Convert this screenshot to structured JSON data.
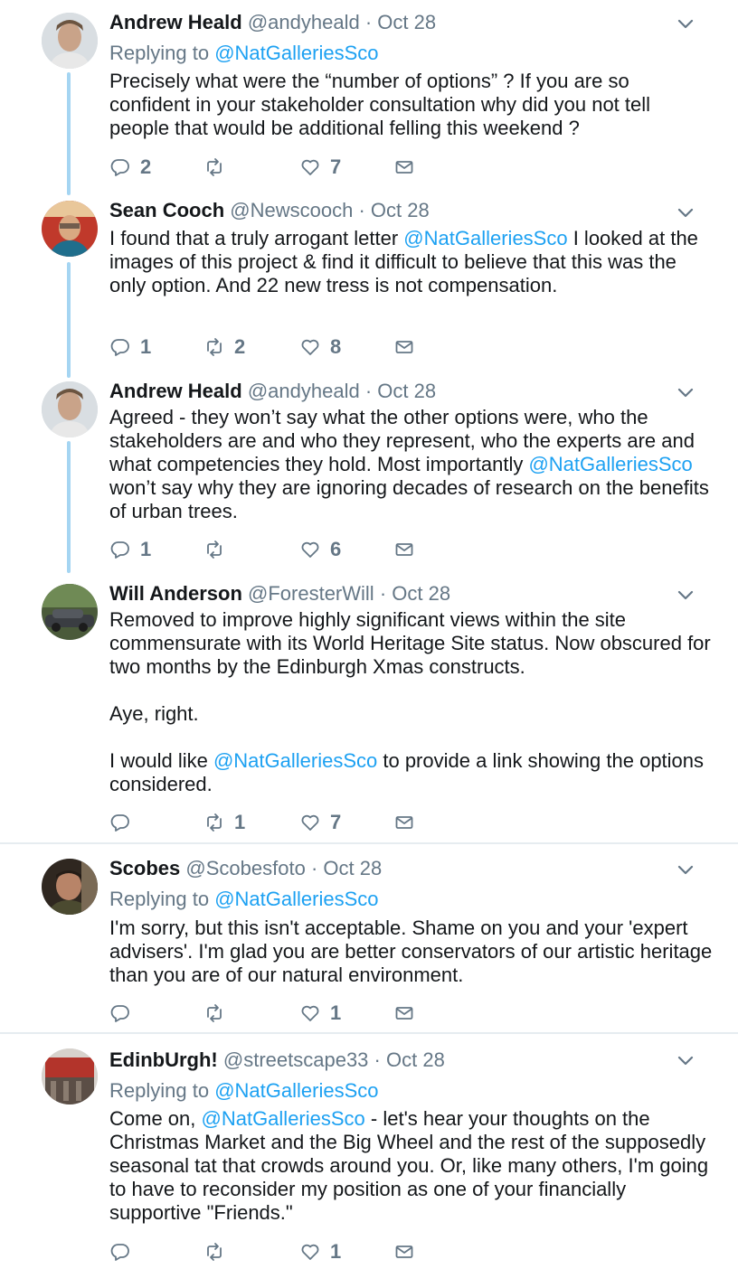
{
  "tweets": [
    {
      "name": "Andrew Heald",
      "handle": "@andyheald",
      "sep": "·",
      "time": "Oct 28",
      "replying_prefix": "Replying to",
      "replying_to": "@NatGalleriesSco",
      "text_segments": [
        [
          "Precisely what were the “number of options” ? If you are so confident  in your stakeholder consultation why did you not tell people that would be additional felling this weekend ?",
          false
        ]
      ],
      "replies": "2",
      "retweets": "",
      "likes": "7"
    },
    {
      "name": "Sean Cooch",
      "handle": "@Newscooch",
      "sep": "·",
      "time": "Oct 28",
      "text_segments": [
        [
          "I found that a truly arrogant letter ",
          false
        ],
        [
          "@NatGalleriesSco",
          true
        ],
        [
          " I looked at the images of this project & find it difficult to believe that this was the only option. And 22 new tress is not compensation.",
          false
        ]
      ],
      "replies": "1",
      "retweets": "2",
      "likes": "8"
    },
    {
      "name": "Andrew Heald",
      "handle": "@andyheald",
      "sep": "·",
      "time": "Oct 28",
      "text_segments": [
        [
          "Agreed - they won’t say what the other options were, who the stakeholders are and who they represent, who the experts are and what competencies they hold. Most importantly ",
          false
        ],
        [
          "@NatGalleriesSco",
          true
        ],
        [
          " won’t say why they are ignoring decades of research on the benefits of urban trees.",
          false
        ]
      ],
      "replies": "1",
      "retweets": "",
      "likes": "6"
    },
    {
      "name": "Will Anderson",
      "handle": "@ForesterWill",
      "sep": "·",
      "time": "Oct 28",
      "paragraphs": [
        [
          [
            "Removed to improve highly significant views within the site commensurate with its World Heritage Site status. Now obscured for two months by the Edinburgh Xmas constructs.",
            false
          ]
        ],
        [
          [
            "Aye, right.",
            false
          ]
        ],
        [
          [
            "I would like ",
            false
          ],
          [
            "@NatGalleriesSco",
            true
          ],
          [
            " to provide a link showing the options considered.",
            false
          ]
        ]
      ],
      "replies": "",
      "retweets": "1",
      "likes": "7"
    },
    {
      "name": "Scobes",
      "handle": "@Scobesfoto",
      "sep": "·",
      "time": "Oct 28",
      "replying_prefix": "Replying to",
      "replying_to": "@NatGalleriesSco",
      "text_segments": [
        [
          "I'm sorry, but this isn't acceptable. Shame on you and your 'expert advisers'. I'm glad you are better conservators of our artistic heritage than you are of our natural environment.",
          false
        ]
      ],
      "replies": "",
      "retweets": "",
      "likes": "1"
    },
    {
      "name": "EdinbUrgh!",
      "handle": "@streetscape33",
      "sep": "·",
      "time": "Oct 28",
      "replying_prefix": "Replying to",
      "replying_to": "@NatGalleriesSco",
      "text_segments": [
        [
          "Come on, ",
          false
        ],
        [
          "@NatGalleriesSco",
          true
        ],
        [
          " - let's hear your thoughts on the Christmas Market and the Big Wheel and the rest of the supposedly seasonal tat that crowds around you. Or, like many others, I'm going to have to reconsider my position as one of your financially supportive \"Friends.\"",
          false
        ]
      ],
      "replies": "",
      "retweets": "",
      "likes": "1"
    }
  ],
  "icons": {
    "reply": "reply-icon",
    "retweet": "retweet-icon",
    "like": "heart-icon",
    "dm": "envelope-icon",
    "caret": "chevron-down-icon"
  },
  "colors": {
    "link": "#1da1f2",
    "muted": "#657786",
    "thread_line": "#a5d5f2",
    "divider": "#e6ecf0"
  }
}
